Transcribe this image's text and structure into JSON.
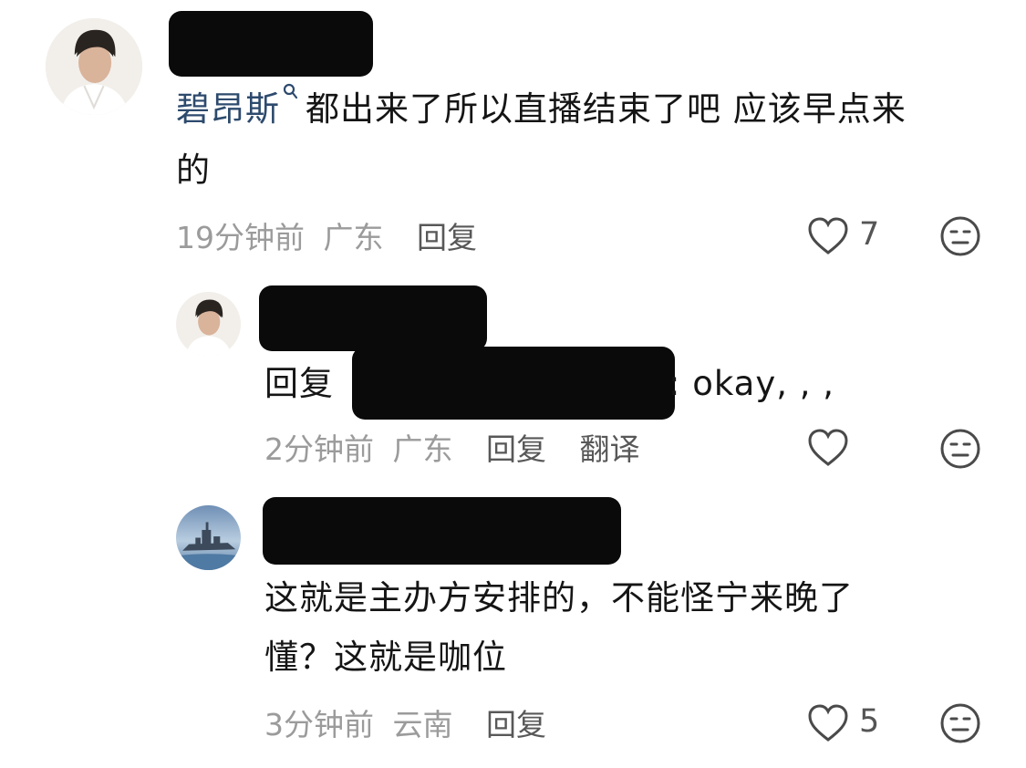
{
  "comments": [
    {
      "mention": "碧昂斯",
      "text": "都出来了所以直播结束了吧 应该早点来",
      "text_wrap": "的",
      "time": "19分钟前",
      "location": "广东",
      "reply_label": "回复",
      "likes": "7"
    },
    {
      "reply_prefix": "回复",
      "text": ": okay, , ,",
      "time": "2分钟前",
      "location": "广东",
      "reply_label": "回复",
      "translate_label": "翻译",
      "likes": ""
    },
    {
      "text_line1": "这就是主办方安排的，不能怪宁来晚了",
      "text_line2": "懂？这就是咖位",
      "time": "3分钟前",
      "location": "云南",
      "reply_label": "回复",
      "likes": "5"
    }
  ],
  "icons": {
    "like": "heart-outline-icon",
    "reaction": "neutral-face-icon",
    "mention": "search-person-icon"
  },
  "colors": {
    "mention": "#2d4a6d",
    "meta": "#9b9b9b",
    "action": "#585858",
    "redaction": "#0a0a0a"
  }
}
